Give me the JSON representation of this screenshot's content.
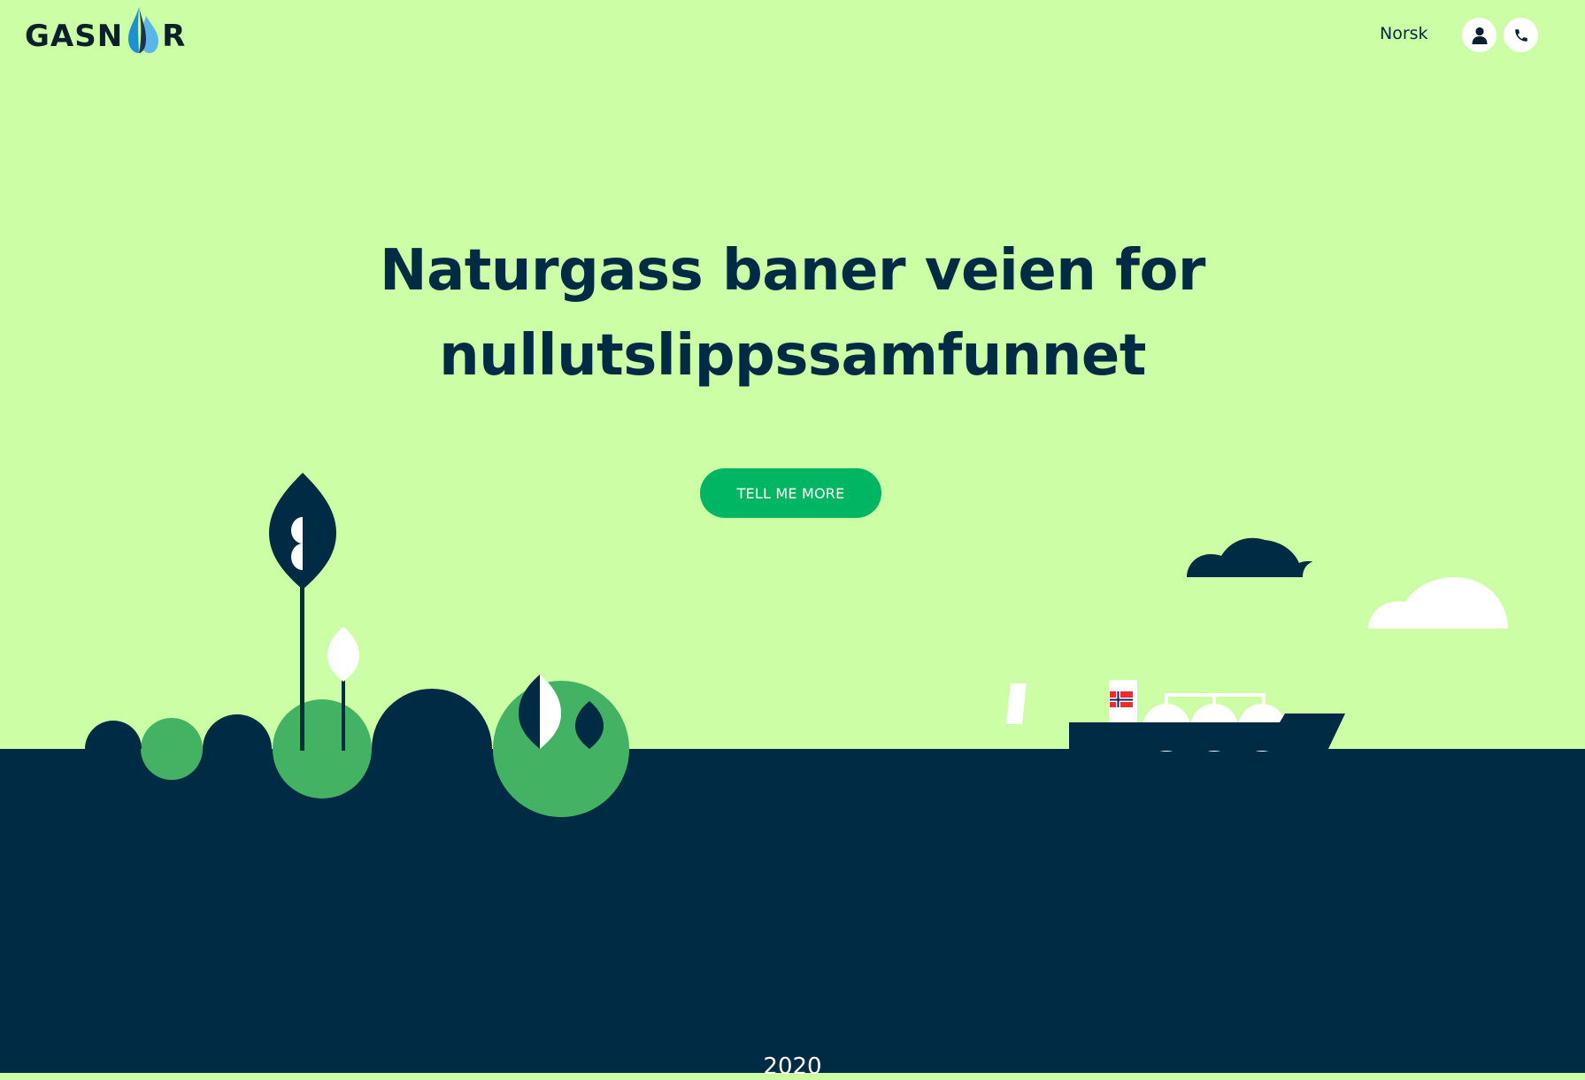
{
  "brand": {
    "logo_text_left": "GASN",
    "logo_text_right": "R",
    "logo_alt": "GASNOR"
  },
  "header": {
    "language_label": "Norsk",
    "user_icon": "user-icon",
    "phone_icon": "phone-icon"
  },
  "hero": {
    "title_line1": "Naturgass baner veien for",
    "title_line2": "nullutslippssamfunnet",
    "cta_label": "TELL ME MORE"
  },
  "timeline": {
    "year": "2020"
  },
  "colors": {
    "sky": "#cbfea5",
    "navy": "#002b45",
    "green_cta": "#00b662",
    "green_pond": "#43b263",
    "white": "#ffffff"
  }
}
